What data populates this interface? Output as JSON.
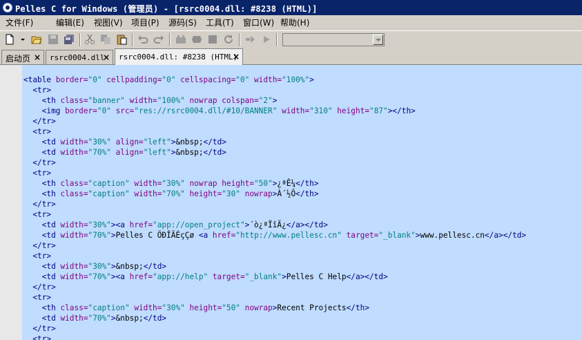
{
  "window": {
    "title": "Pelles C for Windows  (管理员) - [rsrc0004.dll: #8238  (HTML)]"
  },
  "menu": [
    {
      "label": "文件(F)"
    },
    {
      "label": "编辑(E)"
    },
    {
      "label": "视图(V)"
    },
    {
      "label": "项目(P)"
    },
    {
      "label": "源码(S)"
    },
    {
      "label": "工具(T)"
    },
    {
      "label": "窗口(W)"
    },
    {
      "label": "帮助(H)"
    }
  ],
  "toolbar": {
    "icons": [
      "new-file-icon",
      "dropdown-arrow-icon",
      "open-folder-icon",
      "save-icon",
      "save-all-icon",
      "cut-icon",
      "copy-icon",
      "paste-icon",
      "undo-icon",
      "redo-icon",
      "compile-icon",
      "build-icon",
      "stop-icon",
      "rebuild-icon",
      "step-icon",
      "run-icon"
    ],
    "combo_value": ""
  },
  "tabs": [
    {
      "label": "启动页"
    },
    {
      "label": "rsrc0004.dll"
    },
    {
      "label": "rsrc0004.dll: #8238  (HTML)",
      "active": true
    }
  ],
  "code_lines": [
    [
      [
        "tag",
        "<table "
      ],
      [
        "attr",
        "border="
      ],
      [
        "val",
        "\"0\""
      ],
      [
        "attr",
        " cellpadding="
      ],
      [
        "val",
        "\"0\""
      ],
      [
        "attr",
        " cellspacing="
      ],
      [
        "val",
        "\"0\""
      ],
      [
        "attr",
        " width="
      ],
      [
        "val",
        "\"100%\""
      ],
      [
        "tag",
        ">"
      ]
    ],
    [
      [
        "txt",
        "  "
      ],
      [
        "tag",
        "<tr>"
      ]
    ],
    [
      [
        "txt",
        "    "
      ],
      [
        "tag",
        "<th "
      ],
      [
        "attr",
        "class="
      ],
      [
        "val",
        "\"banner\""
      ],
      [
        "attr",
        " width="
      ],
      [
        "val",
        "\"100%\""
      ],
      [
        "attr",
        " nowrap colspan="
      ],
      [
        "val",
        "\"2\""
      ],
      [
        "tag",
        ">"
      ]
    ],
    [
      [
        "txt",
        "    "
      ],
      [
        "tag",
        "<img "
      ],
      [
        "attr",
        "border="
      ],
      [
        "val",
        "\"0\""
      ],
      [
        "attr",
        " src="
      ],
      [
        "val",
        "\"res://rsrc0004.dll/#10/BANNER\""
      ],
      [
        "attr",
        " width="
      ],
      [
        "val",
        "\"310\""
      ],
      [
        "attr",
        " height="
      ],
      [
        "val",
        "\"87\""
      ],
      [
        "tag",
        "></th>"
      ]
    ],
    [
      [
        "txt",
        "  "
      ],
      [
        "tag",
        "</tr>"
      ]
    ],
    [
      [
        "txt",
        "  "
      ],
      [
        "tag",
        "<tr>"
      ]
    ],
    [
      [
        "txt",
        "    "
      ],
      [
        "tag",
        "<td "
      ],
      [
        "attr",
        "width="
      ],
      [
        "val",
        "\"30%\""
      ],
      [
        "attr",
        " align="
      ],
      [
        "val",
        "\"left\""
      ],
      [
        "tag",
        ">"
      ],
      [
        "txt",
        "&nbsp;"
      ],
      [
        "tag",
        "</td>"
      ]
    ],
    [
      [
        "txt",
        "    "
      ],
      [
        "tag",
        "<td "
      ],
      [
        "attr",
        "width="
      ],
      [
        "val",
        "\"70%\""
      ],
      [
        "attr",
        " align="
      ],
      [
        "val",
        "\"left\""
      ],
      [
        "tag",
        ">"
      ],
      [
        "txt",
        "&nbsp;"
      ],
      [
        "tag",
        "</td>"
      ]
    ],
    [
      [
        "txt",
        "  "
      ],
      [
        "tag",
        "</tr>"
      ]
    ],
    [
      [
        "txt",
        "  "
      ],
      [
        "tag",
        "<tr>"
      ]
    ],
    [
      [
        "txt",
        "    "
      ],
      [
        "tag",
        "<th "
      ],
      [
        "attr",
        "class="
      ],
      [
        "val",
        "\"caption\""
      ],
      [
        "attr",
        " width="
      ],
      [
        "val",
        "\"30%\""
      ],
      [
        "attr",
        " nowrap height="
      ],
      [
        "val",
        "\"50\""
      ],
      [
        "tag",
        ">"
      ],
      [
        "txt",
        "¿ªÊ¼"
      ],
      [
        "tag",
        "</th>"
      ]
    ],
    [
      [
        "txt",
        "    "
      ],
      [
        "tag",
        "<th "
      ],
      [
        "attr",
        "class="
      ],
      [
        "val",
        "\"caption\""
      ],
      [
        "attr",
        " width="
      ],
      [
        "val",
        "\"70%\""
      ],
      [
        "attr",
        " height="
      ],
      [
        "val",
        "\"30\""
      ],
      [
        "attr",
        " nowrap"
      ],
      [
        "tag",
        ">"
      ],
      [
        "txt",
        "À´½Ô"
      ],
      [
        "tag",
        "</th>"
      ]
    ],
    [
      [
        "txt",
        "  "
      ],
      [
        "tag",
        "</tr>"
      ]
    ],
    [
      [
        "txt",
        "  "
      ],
      [
        "tag",
        "<tr>"
      ]
    ],
    [
      [
        "txt",
        "    "
      ],
      [
        "tag",
        "<td "
      ],
      [
        "attr",
        "width="
      ],
      [
        "val",
        "\"30%\""
      ],
      [
        "tag",
        "><a "
      ],
      [
        "attr",
        "href="
      ],
      [
        "val",
        "\"app://open_project\""
      ],
      [
        "tag",
        ">"
      ],
      [
        "txt",
        "´ò¿ªÏîÄ¿"
      ],
      [
        "tag",
        "</a></td>"
      ]
    ],
    [
      [
        "txt",
        "    "
      ],
      [
        "tag",
        "<td "
      ],
      [
        "attr",
        "width="
      ],
      [
        "val",
        "\"70%\""
      ],
      [
        "tag",
        ">"
      ],
      [
        "txt",
        "Pelles C ÖÐÎÄÉçÇø "
      ],
      [
        "tag",
        "<a "
      ],
      [
        "attr",
        "href="
      ],
      [
        "val",
        "\"http://www.pellesc.cn\""
      ],
      [
        "attr",
        " target="
      ],
      [
        "val",
        "\"_blank\""
      ],
      [
        "tag",
        ">"
      ],
      [
        "txt",
        "www.pellesc.cn"
      ],
      [
        "tag",
        "</a></td>"
      ]
    ],
    [
      [
        "txt",
        "  "
      ],
      [
        "tag",
        "</tr>"
      ]
    ],
    [
      [
        "txt",
        "  "
      ],
      [
        "tag",
        "<tr>"
      ]
    ],
    [
      [
        "txt",
        "    "
      ],
      [
        "tag",
        "<td "
      ],
      [
        "attr",
        "width="
      ],
      [
        "val",
        "\"30%\""
      ],
      [
        "tag",
        ">"
      ],
      [
        "txt",
        "&nbsp;"
      ],
      [
        "tag",
        "</td>"
      ]
    ],
    [
      [
        "txt",
        "    "
      ],
      [
        "tag",
        "<td "
      ],
      [
        "attr",
        "width="
      ],
      [
        "val",
        "\"70%\""
      ],
      [
        "tag",
        "><a "
      ],
      [
        "attr",
        "href="
      ],
      [
        "val",
        "\"app://help\""
      ],
      [
        "attr",
        " target="
      ],
      [
        "val",
        "\"_blank\""
      ],
      [
        "tag",
        ">"
      ],
      [
        "txt",
        "Pelles C Help"
      ],
      [
        "tag",
        "</a></td>"
      ]
    ],
    [
      [
        "txt",
        "  "
      ],
      [
        "tag",
        "</tr>"
      ]
    ],
    [
      [
        "txt",
        "  "
      ],
      [
        "tag",
        "<tr>"
      ]
    ],
    [
      [
        "txt",
        "    "
      ],
      [
        "tag",
        "<th "
      ],
      [
        "attr",
        "class="
      ],
      [
        "val",
        "\"caption\""
      ],
      [
        "attr",
        " width="
      ],
      [
        "val",
        "\"30%\""
      ],
      [
        "attr",
        " height="
      ],
      [
        "val",
        "\"50\""
      ],
      [
        "attr",
        " nowrap"
      ],
      [
        "tag",
        ">"
      ],
      [
        "txt",
        "Recent Projects"
      ],
      [
        "tag",
        "</th>"
      ]
    ],
    [
      [
        "txt",
        "    "
      ],
      [
        "tag",
        "<td "
      ],
      [
        "attr",
        "width="
      ],
      [
        "val",
        "\"70%\""
      ],
      [
        "tag",
        ">"
      ],
      [
        "txt",
        "&nbsp;"
      ],
      [
        "tag",
        "</td>"
      ]
    ],
    [
      [
        "txt",
        "  "
      ],
      [
        "tag",
        "</tr>"
      ]
    ],
    [
      [
        "txt",
        "  "
      ],
      [
        "tag",
        "<tr>"
      ]
    ]
  ]
}
